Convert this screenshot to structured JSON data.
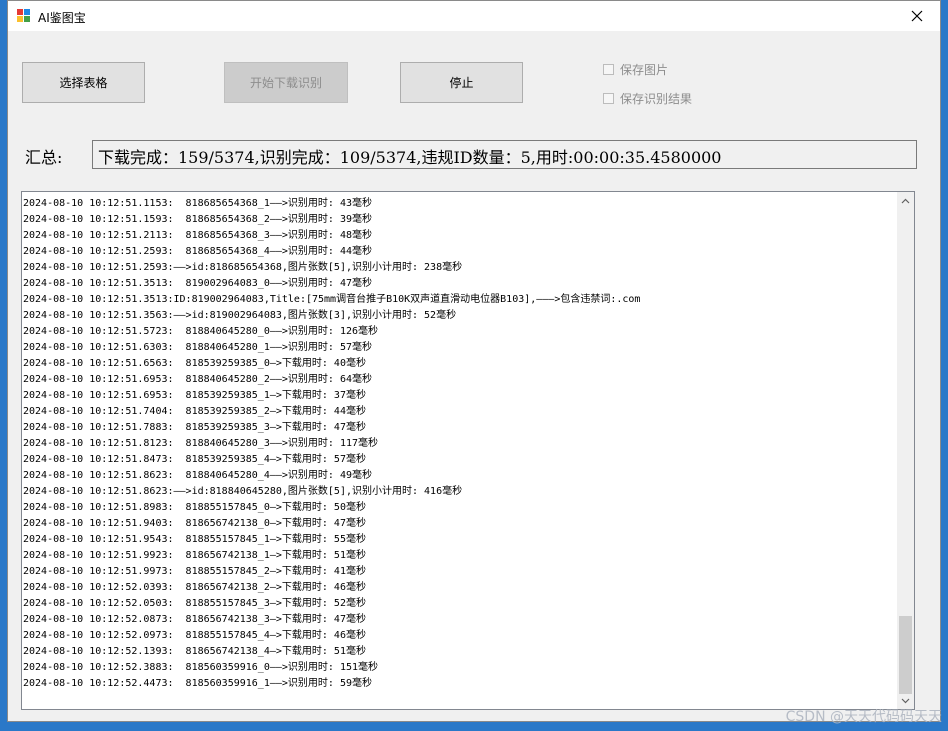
{
  "window": {
    "title": "AI鉴图宝"
  },
  "toolbar": {
    "select_label": "选择表格",
    "start_label": "开始下载识别",
    "stop_label": "停止",
    "save_images_label": "保存图片",
    "save_results_label": "保存识别结果"
  },
  "summary": {
    "label": "汇总:",
    "text": "下载完成：159/5374,识别完成：109/5374,违规ID数量：5,用时:00:00:35.4580000"
  },
  "log": {
    "lines": [
      "2024-08-10 10:12:51.1153:  818685654368_1——>识别用时: 43毫秒",
      "2024-08-10 10:12:51.1593:  818685654368_2——>识别用时: 39毫秒",
      "2024-08-10 10:12:51.2113:  818685654368_3——>识别用时: 48毫秒",
      "2024-08-10 10:12:51.2593:  818685654368_4——>识别用时: 44毫秒",
      "2024-08-10 10:12:51.2593:——>id:818685654368,图片张数[5],识别小计用时: 238毫秒",
      "2024-08-10 10:12:51.3513:  819002964083_0——>识别用时: 47毫秒",
      "2024-08-10 10:12:51.3513:ID:819002964083,Title:[75mm调音台推子B10K双声道直滑动电位器B103],———>包含违禁词:.com",
      "2024-08-10 10:12:51.3563:——>id:819002964083,图片张数[3],识别小计用时: 52毫秒",
      "2024-08-10 10:12:51.5723:  818840645280_0——>识别用时: 126毫秒",
      "2024-08-10 10:12:51.6303:  818840645280_1——>识别用时: 57毫秒",
      "2024-08-10 10:12:51.6563:  818539259385_0—>下载用时: 40毫秒",
      "2024-08-10 10:12:51.6953:  818840645280_2——>识别用时: 64毫秒",
      "2024-08-10 10:12:51.6953:  818539259385_1—>下载用时: 37毫秒",
      "2024-08-10 10:12:51.7404:  818539259385_2—>下载用时: 44毫秒",
      "2024-08-10 10:12:51.7883:  818539259385_3—>下载用时: 47毫秒",
      "2024-08-10 10:12:51.8123:  818840645280_3——>识别用时: 117毫秒",
      "2024-08-10 10:12:51.8473:  818539259385_4—>下载用时: 57毫秒",
      "2024-08-10 10:12:51.8623:  818840645280_4——>识别用时: 49毫秒",
      "2024-08-10 10:12:51.8623:——>id:818840645280,图片张数[5],识别小计用时: 416毫秒",
      "2024-08-10 10:12:51.8983:  818855157845_0—>下载用时: 50毫秒",
      "2024-08-10 10:12:51.9403:  818656742138_0—>下载用时: 47毫秒",
      "2024-08-10 10:12:51.9543:  818855157845_1—>下载用时: 55毫秒",
      "2024-08-10 10:12:51.9923:  818656742138_1—>下载用时: 51毫秒",
      "2024-08-10 10:12:51.9973:  818855157845_2—>下载用时: 41毫秒",
      "2024-08-10 10:12:52.0393:  818656742138_2—>下载用时: 46毫秒",
      "2024-08-10 10:12:52.0503:  818855157845_3—>下载用时: 52毫秒",
      "2024-08-10 10:12:52.0873:  818656742138_3—>下载用时: 47毫秒",
      "2024-08-10 10:12:52.0973:  818855157845_4—>下载用时: 46毫秒",
      "2024-08-10 10:12:52.1393:  818656742138_4—>下载用时: 51毫秒",
      "2024-08-10 10:12:52.3883:  818560359916_0——>识别用时: 151毫秒",
      "2024-08-10 10:12:52.4473:  818560359916_1——>识别用时: 59毫秒"
    ]
  },
  "watermark": "CSDN @天天代码码天天",
  "icons": {
    "app": "app-logo-icon",
    "close": "close-icon",
    "scroll_up": "chevron-up-icon",
    "scroll_down": "chevron-down-icon"
  },
  "colors": {
    "desktop": "#2a78c8",
    "window_bg": "#f0f0f0",
    "button_bg": "#e1e1e1",
    "disabled_text": "#8d8d8d"
  }
}
